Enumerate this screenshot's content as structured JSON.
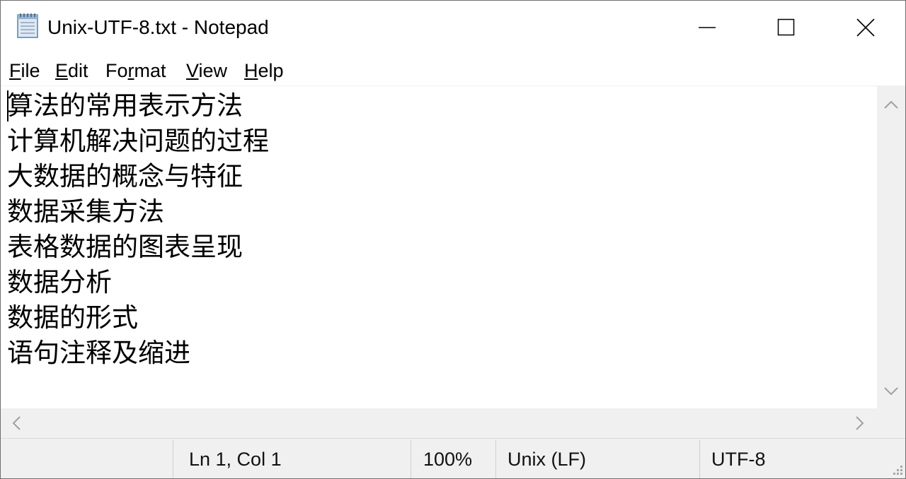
{
  "window": {
    "title": "Unix-UTF-8.txt - Notepad",
    "icon": "notepad-icon"
  },
  "title_controls": {
    "minimize_icon": "minimize-icon",
    "maximize_icon": "maximize-icon",
    "close_icon": "close-icon"
  },
  "menu": {
    "file": {
      "first": "F",
      "rest": "ile"
    },
    "edit": {
      "first": "E",
      "rest": "dit"
    },
    "format": {
      "first": "Fo",
      "u": "r",
      "rest": "mat"
    },
    "view": {
      "first": "V",
      "rest": "iew"
    },
    "help": {
      "first": "H",
      "rest": "elp"
    }
  },
  "editor": {
    "lines": [
      "算法的常用表示方法",
      "计算机解决问题的过程",
      "大数据的概念与特征",
      "数据采集方法",
      "表格数据的图表呈现",
      "数据分析",
      "数据的形式",
      "语句注释及缩进"
    ]
  },
  "status": {
    "position": "Ln 1, Col 1",
    "zoom": "100%",
    "line_ending": "Unix (LF)",
    "encoding": "UTF-8"
  },
  "colors": {
    "chrome": "#f0f0f0",
    "text": "#000000",
    "arrow": "#a0a0a0"
  }
}
